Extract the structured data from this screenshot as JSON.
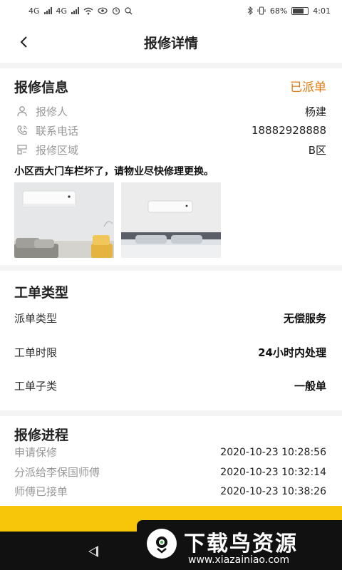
{
  "status_bar": {
    "network1": "4G",
    "network2": "4G",
    "battery": "68%",
    "time": "4:01"
  },
  "header": {
    "title": "报修详情"
  },
  "repair_info": {
    "section_title": "报修信息",
    "status": "已派单",
    "rows": [
      {
        "icon": "person-icon",
        "label": "报修人",
        "value": "杨建"
      },
      {
        "icon": "phone-icon",
        "label": "联系电话",
        "value": "18882928888"
      },
      {
        "icon": "area-icon",
        "label": "报修区域",
        "value": "B区"
      }
    ],
    "description": "小区西大门车栏坏了，请物业尽快修理更换。",
    "photos": [
      "aircon-living-room",
      "aircon-bedroom"
    ]
  },
  "work_order": {
    "section_title": "工单类型",
    "rows": [
      {
        "label": "派单类型",
        "value": "无偿服务"
      },
      {
        "label": "工单时限",
        "value": "24小时内处理"
      },
      {
        "label": "工单子类",
        "value": "一般单"
      }
    ]
  },
  "progress": {
    "section_title": "报修进程",
    "rows": [
      {
        "label": "申请保修",
        "time": "2020-10-23 10:28:56"
      },
      {
        "label": "分派给李保国师傅",
        "time": "2020-10-23 10:32:14"
      },
      {
        "label": "师傅已接单",
        "time": "2020-10-23 10:38:26"
      }
    ]
  },
  "watermark": {
    "title": "下载鸟资源",
    "url": "www.xiazainiao.com"
  },
  "colors": {
    "accent": "#e07b13",
    "footer_yellow": "#f7c60b"
  }
}
